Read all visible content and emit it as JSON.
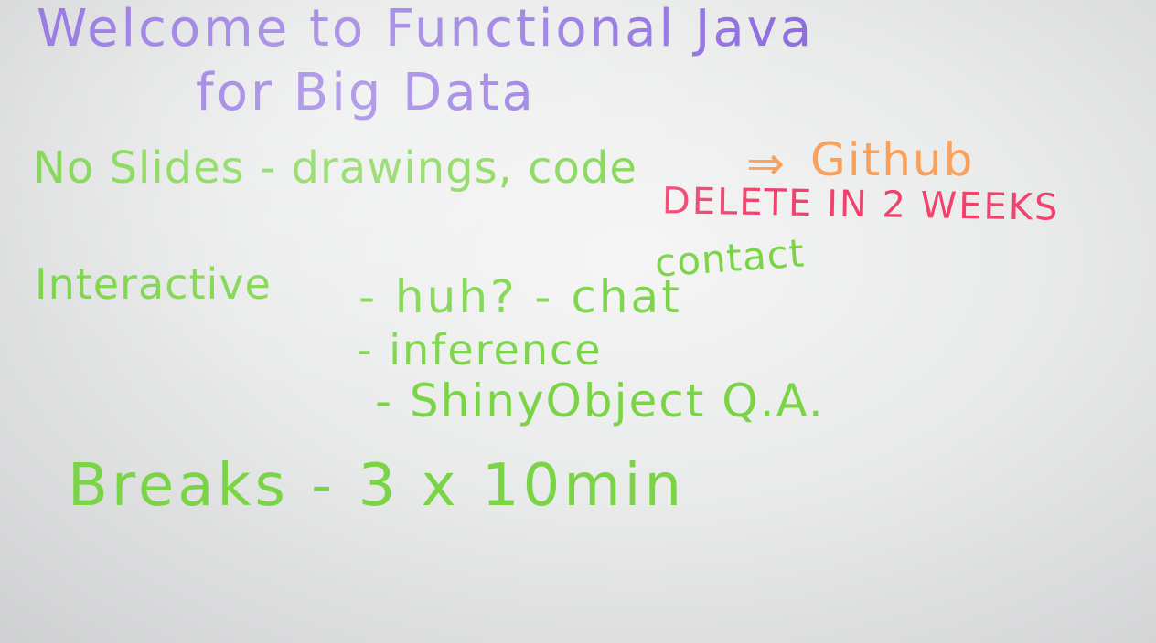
{
  "whiteboard": {
    "title_line1": "Welcome to Functional Java",
    "title_line2": "for Big Data",
    "line_slides": "No Slides - drawings, code",
    "arrow": "⇒",
    "github": "Github",
    "delete_note": "DELETE IN 2 WEEKS",
    "contact": "contact",
    "interactive": "Interactive",
    "item_huh": "- huh? - chat",
    "item_inference": "- inference",
    "item_shiny": "- ShinyObject Q.A.",
    "breaks": "Breaks - 3 x 10min"
  },
  "colors": {
    "purple_marker": "#8e6de0",
    "green_marker": "#7ad446",
    "orange_marker": "#f8a05c",
    "red_marker": "#f0426d",
    "board": "#e9eaea"
  }
}
